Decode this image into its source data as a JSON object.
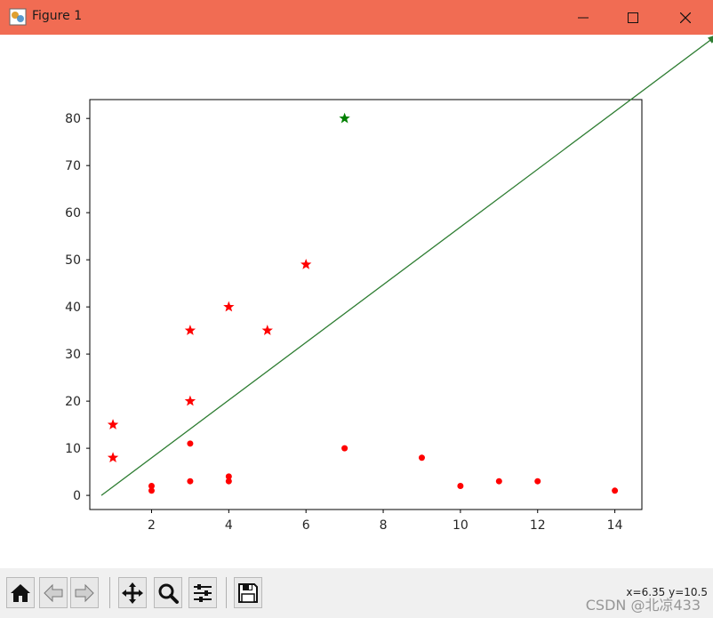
{
  "window": {
    "title": "Figure 1",
    "icon": "figure-icon",
    "controls": [
      "minimize-icon",
      "maximize-icon",
      "close-icon"
    ],
    "titlebar_color": "#f16c53"
  },
  "toolbar": {
    "buttons": [
      "home-icon",
      "back-arrow-icon",
      "forward-arrow-icon",
      "pan-icon",
      "zoom-icon",
      "configure-subplots-icon",
      "save-icon"
    ],
    "coords_text": "x=6.35 y=10.5",
    "watermark": "CSDN @北凉433"
  },
  "chart_data": {
    "type": "scatter",
    "title": "",
    "xlabel": "",
    "ylabel": "",
    "xlim": [
      0.4,
      14.7
    ],
    "ylim": [
      -3,
      84
    ],
    "xticks": [
      2,
      4,
      6,
      8,
      10,
      12,
      14
    ],
    "yticks": [
      0,
      10,
      20,
      30,
      40,
      50,
      60,
      70,
      80
    ],
    "grid": false,
    "series": [
      {
        "marker": "dot",
        "color": "#ff0000",
        "points": [
          [
            2,
            1
          ],
          [
            2,
            2
          ],
          [
            3,
            3
          ],
          [
            3,
            11
          ],
          [
            4,
            3
          ],
          [
            4,
            4
          ],
          [
            7,
            10
          ],
          [
            9,
            8
          ],
          [
            10,
            2
          ],
          [
            11,
            3
          ],
          [
            12,
            3
          ],
          [
            14,
            1
          ]
        ]
      },
      {
        "marker": "star",
        "color": "#ff0000",
        "points": [
          [
            1,
            8
          ],
          [
            1,
            15
          ],
          [
            3,
            20
          ],
          [
            3,
            35
          ],
          [
            4,
            40
          ],
          [
            5,
            35
          ],
          [
            6,
            49
          ]
        ]
      },
      {
        "marker": "star",
        "color": "#008000",
        "points": [
          [
            7,
            80
          ]
        ]
      }
    ],
    "arrow": {
      "color": "#2e7d32",
      "from": [
        0.7,
        0
      ],
      "to": [
        16.7,
        98
      ]
    }
  }
}
